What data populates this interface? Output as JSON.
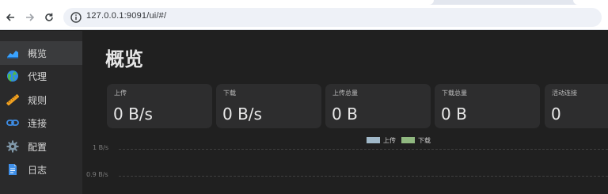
{
  "browser": {
    "url": "127.0.0.1:9091/ui/#/",
    "icons": {
      "back": "arrow-left-icon",
      "forward": "arrow-right-icon",
      "reload": "reload-icon",
      "site_info": "info-icon"
    }
  },
  "sidebar": {
    "items": [
      {
        "label": "概览",
        "icon": "chart-area-icon",
        "active": true
      },
      {
        "label": "代理",
        "icon": "globe-icon",
        "active": false
      },
      {
        "label": "规则",
        "icon": "ruler-icon",
        "active": false
      },
      {
        "label": "连接",
        "icon": "link-icon",
        "active": false
      },
      {
        "label": "配置",
        "icon": "gear-icon",
        "active": false
      },
      {
        "label": "日志",
        "icon": "document-icon",
        "active": false
      }
    ]
  },
  "main": {
    "title": "概览",
    "cards": [
      {
        "label": "上传",
        "value": "0 B/s"
      },
      {
        "label": "下载",
        "value": "0 B/s"
      },
      {
        "label": "上传总量",
        "value": "0 B"
      },
      {
        "label": "下载总量",
        "value": "0 B"
      },
      {
        "label": "活动连接",
        "value": "0"
      }
    ]
  },
  "chart_data": {
    "type": "line",
    "series": [
      {
        "name": "上传",
        "color": "#a0b8c8",
        "values": []
      },
      {
        "name": "下载",
        "color": "#90b880",
        "values": []
      }
    ],
    "yticks": [
      "1 B/s",
      "0.9 B/s"
    ],
    "legend": "top-center",
    "grid": true
  }
}
